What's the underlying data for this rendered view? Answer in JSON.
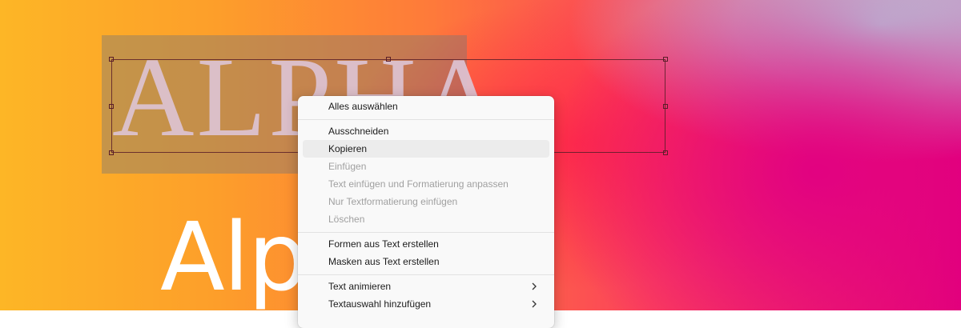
{
  "canvas": {
    "serif_text": "ALPHA",
    "sans_text": "Alpha"
  },
  "context_menu": {
    "items": [
      {
        "label": "Alles auswählen",
        "enabled": true
      },
      {
        "label": "Ausschneiden",
        "enabled": true
      },
      {
        "label": "Kopieren",
        "enabled": true,
        "highlighted": true
      },
      {
        "label": "Einfügen",
        "enabled": false
      },
      {
        "label": "Text einfügen und Formatierung anpassen",
        "enabled": false
      },
      {
        "label": "Nur Textformatierung einfügen",
        "enabled": false
      },
      {
        "label": "Löschen",
        "enabled": false
      },
      {
        "label": "Formen aus Text erstellen",
        "enabled": true
      },
      {
        "label": "Masken aus Text erstellen",
        "enabled": true
      },
      {
        "label": "Text animieren",
        "enabled": true,
        "submenu": true
      },
      {
        "label": "Textauswahl hinzufügen",
        "enabled": true,
        "submenu": true
      }
    ],
    "submenu_icon": "chevron-right-icon"
  },
  "colors": {
    "gradient_left": "#fdb626",
    "gradient_mid": "#fb3f5c",
    "gradient_right": "#e2007c",
    "gradient_top_right": "#b4d6e2",
    "selection_box": "#5a1e28",
    "menu_background": "#f9f9f9",
    "disabled_text": "#a0a0a0"
  }
}
